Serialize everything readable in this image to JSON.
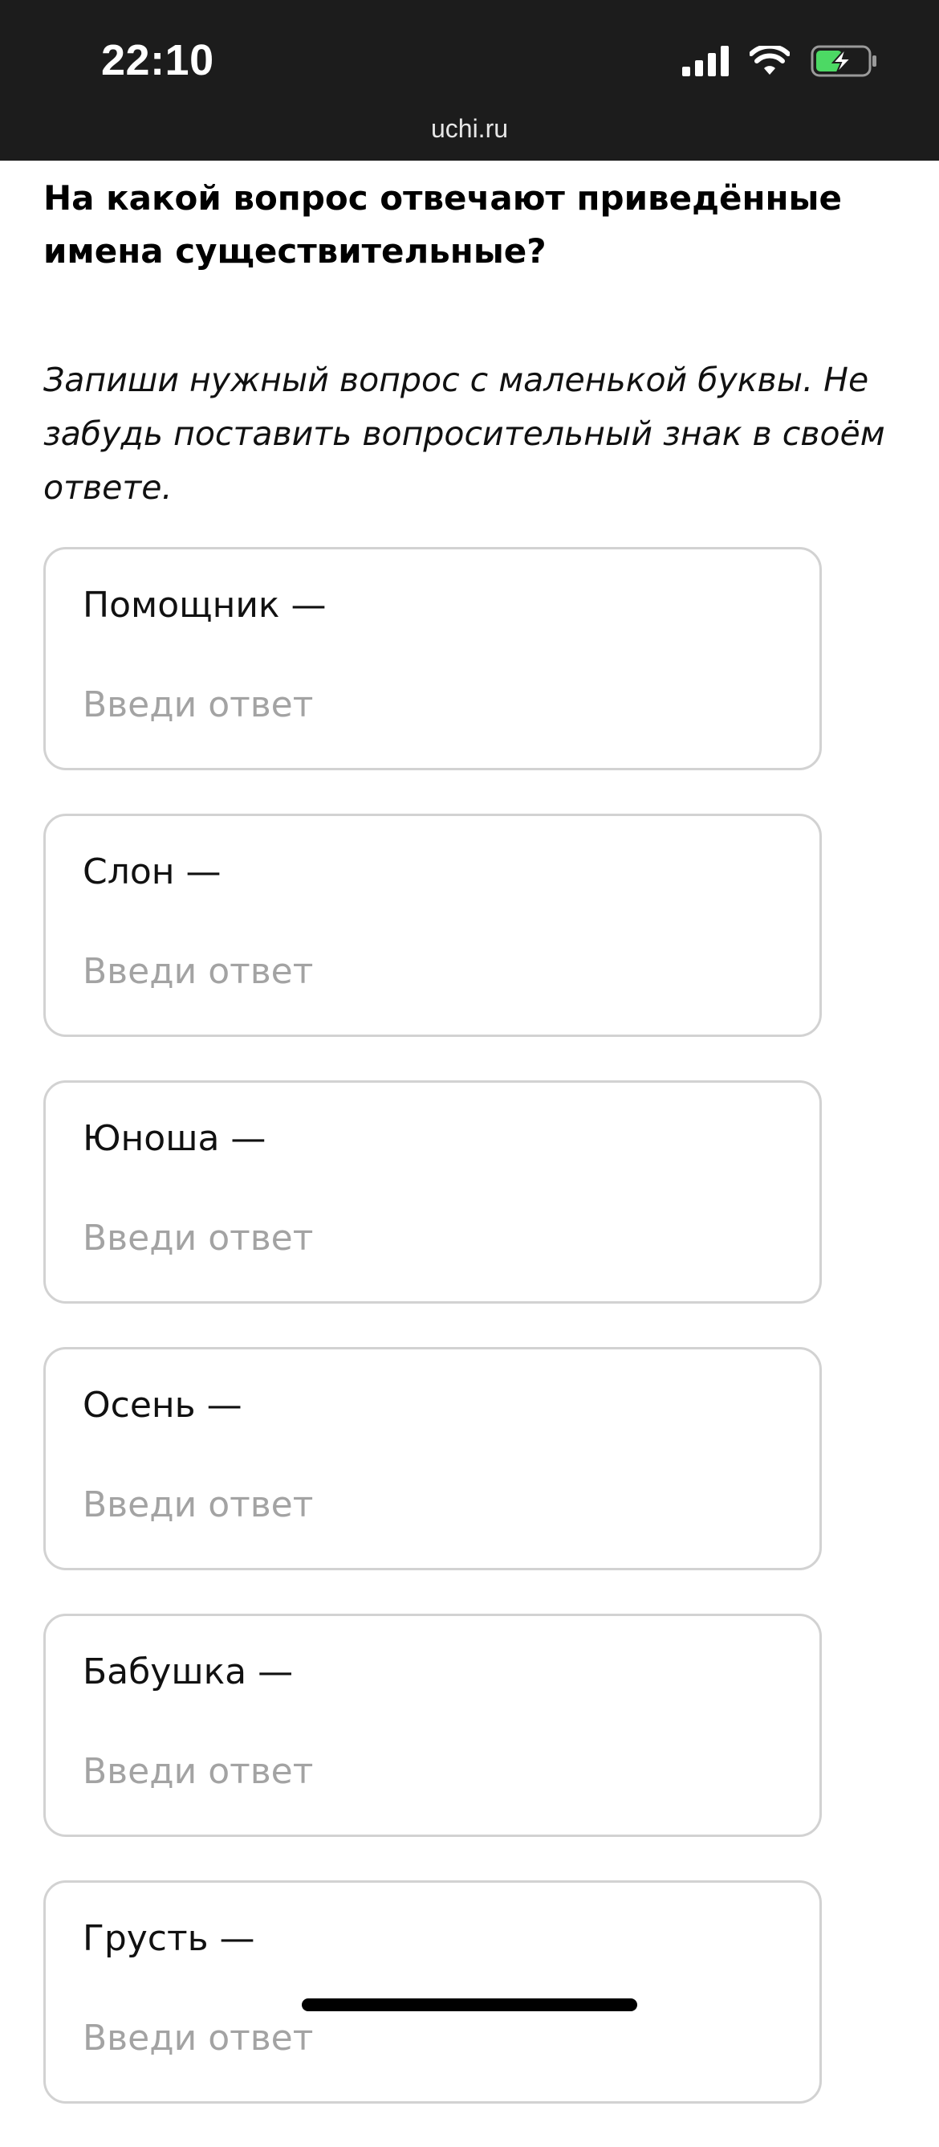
{
  "status_bar": {
    "time": "22:10",
    "battery_color": "#4cd964"
  },
  "url_bar": {
    "domain": "uchi.ru"
  },
  "task": {
    "question": "На какой вопрос отвечают приведённые имена существительные?",
    "instruction": "Запиши нужный вопрос с маленькой буквы. Не забудь поставить вопросительный знак в своём ответе."
  },
  "answers": [
    {
      "label": "Помощник —",
      "value": "",
      "placeholder": "Введи ответ"
    },
    {
      "label": "Слон —",
      "value": "",
      "placeholder": "Введи ответ"
    },
    {
      "label": "Юноша —",
      "value": "",
      "placeholder": "Введи ответ"
    },
    {
      "label": "Осень —",
      "value": "",
      "placeholder": "Введи ответ"
    },
    {
      "label": "Бабушка —",
      "value": "",
      "placeholder": "Введи ответ"
    },
    {
      "label": "Грусть —",
      "value": "",
      "placeholder": "Введи ответ"
    }
  ]
}
